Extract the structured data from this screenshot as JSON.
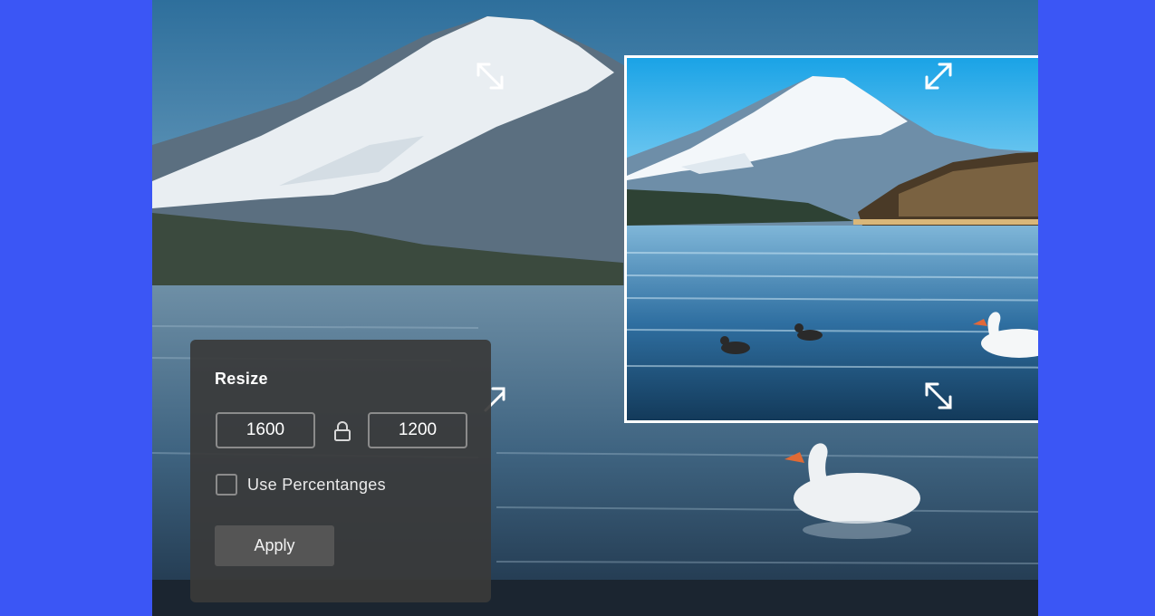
{
  "panel": {
    "title": "Resize",
    "width_value": "1600",
    "height_value": "1200",
    "lock_icon": "lock-icon",
    "use_percentages_label": "Use Percentanges",
    "use_percentages_checked": false,
    "apply_label": "Apply"
  },
  "colors": {
    "page_background": "#3b56f5",
    "panel_background": "#3a3a3a",
    "crop_border": "#ffffff"
  }
}
